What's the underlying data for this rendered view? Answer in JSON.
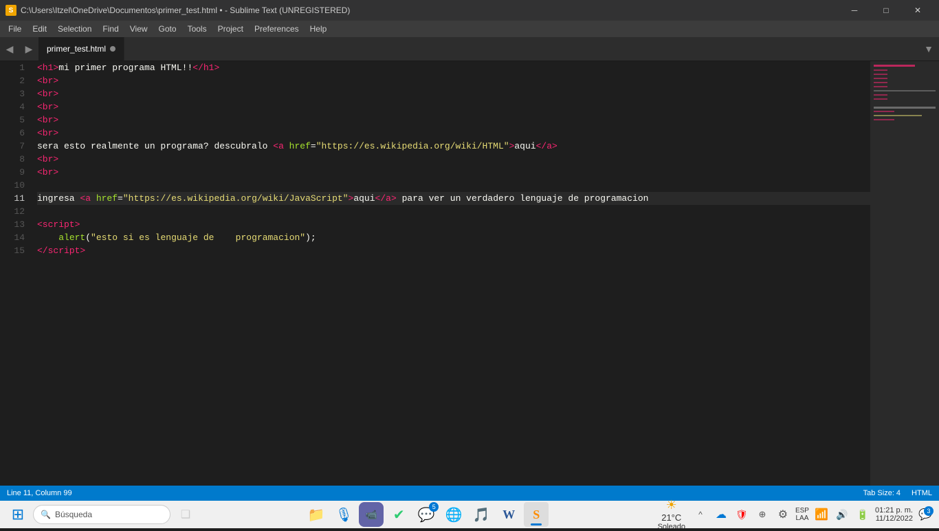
{
  "window": {
    "title": "C:\\Users\\Itzel\\OneDrive\\Documentos\\primer_test.html • - Sublime Text (UNREGISTERED)",
    "icon": "S"
  },
  "title_controls": {
    "minimize": "─",
    "maximize": "□",
    "close": "✕"
  },
  "menu": {
    "items": [
      "File",
      "Edit",
      "Selection",
      "Find",
      "View",
      "Goto",
      "Tools",
      "Project",
      "Preferences",
      "Help"
    ]
  },
  "tabs": {
    "nav_left": "◀",
    "nav_right": "▶",
    "items": [
      {
        "label": "primer_test.html",
        "dot": true,
        "active": true
      }
    ],
    "dropdown": "▼"
  },
  "code": {
    "lines": [
      {
        "num": 1,
        "active": false,
        "html": "<span class='tag'>&lt;h1&gt;</span><span class='plain'>mi primer programa HTML!!</span><span class='tag'>&lt;/h1&gt;</span>"
      },
      {
        "num": 2,
        "active": false,
        "html": "<span class='tag'>&lt;br&gt;</span>"
      },
      {
        "num": 3,
        "active": false,
        "html": "<span class='tag'>&lt;br&gt;</span>"
      },
      {
        "num": 4,
        "active": false,
        "html": "<span class='tag'>&lt;br&gt;</span>"
      },
      {
        "num": 5,
        "active": false,
        "html": "<span class='tag'>&lt;br&gt;</span>"
      },
      {
        "num": 6,
        "active": false,
        "html": "<span class='tag'>&lt;br&gt;</span>"
      },
      {
        "num": 7,
        "active": false,
        "html": "<span class='plain'>sera esto realmente un programa? descubralo </span><span class='tag'>&lt;a </span><span class='attr-name'>href</span><span class='plain'>=</span><span class='attr-val'>\"https://es.wikipedia.org/wiki/HTML\"</span><span class='tag'>&gt;</span><span class='plain'>aqui</span><span class='tag'>&lt;/a&gt;</span>"
      },
      {
        "num": 8,
        "active": false,
        "html": "<span class='tag'>&lt;br&gt;</span>"
      },
      {
        "num": 9,
        "active": false,
        "html": "<span class='tag'>&lt;br&gt;</span>"
      },
      {
        "num": 10,
        "active": false,
        "html": ""
      },
      {
        "num": 11,
        "active": true,
        "html": "<span class='plain'>ingresa </span><span class='tag'>&lt;a </span><span class='attr-name'>href</span><span class='plain'>=</span><span class='attr-val'>\"https://es.wikipedia.org/wiki/JavaScript\"</span><span class='tag'>&gt;</span><span class='plain'>aqui</span><span class='tag'>&lt;/a&gt;</span><span class='plain'> para ver un verdadero lenguaje de programacion</span>"
      },
      {
        "num": 12,
        "active": false,
        "html": ""
      },
      {
        "num": 13,
        "active": false,
        "html": "<span class='tag'>&lt;script&gt;</span>"
      },
      {
        "num": 14,
        "active": false,
        "html": "    <span class='fn-name'>alert</span><span class='plain'>(</span><span class='string-val'>\"esto si es lenguaje de&nbsp;&nbsp;&nbsp;&nbsp;programacion\"</span><span class='plain'>);</span>"
      },
      {
        "num": 15,
        "active": false,
        "html": "<span class='tag'>&lt;/script&gt;</span>"
      }
    ]
  },
  "status": {
    "left": {
      "position": "Line 11, Column 99"
    },
    "right": {
      "tab_size": "Tab Size: 4",
      "language": "HTML"
    }
  },
  "taskbar": {
    "start_icon": "⊞",
    "search_placeholder": "Búsqueda",
    "task_view": "❑",
    "apps": [
      {
        "name": "File Explorer",
        "icon": "📁",
        "active": false
      },
      {
        "name": "Cortana",
        "icon": "🎙",
        "active": false
      },
      {
        "name": "Meet",
        "icon": "📹",
        "active": false
      },
      {
        "name": "ToDo",
        "icon": "✔",
        "active": false
      },
      {
        "name": "WhatsApp",
        "icon": "💬",
        "active": false,
        "badge": "5"
      },
      {
        "name": "Chrome",
        "icon": "🌐",
        "active": false
      },
      {
        "name": "Spotify",
        "icon": "🎵",
        "active": false
      },
      {
        "name": "Word",
        "icon": "W",
        "active": false
      },
      {
        "name": "Sublime",
        "icon": "S",
        "active": true
      }
    ],
    "tray": {
      "chevron": "^",
      "onedrive": "☁",
      "antivirus": "🛡",
      "network_extra": "⚙",
      "settings": "⚙",
      "language": "ESP\nLAA",
      "wifi": "📶",
      "volume": "🔊",
      "battery": "🔋",
      "time": "01:21 p. m.",
      "date": "11/12/2022",
      "notification_badge": "3"
    },
    "weather": {
      "temp": "21°C",
      "condition": "Soleado"
    }
  }
}
